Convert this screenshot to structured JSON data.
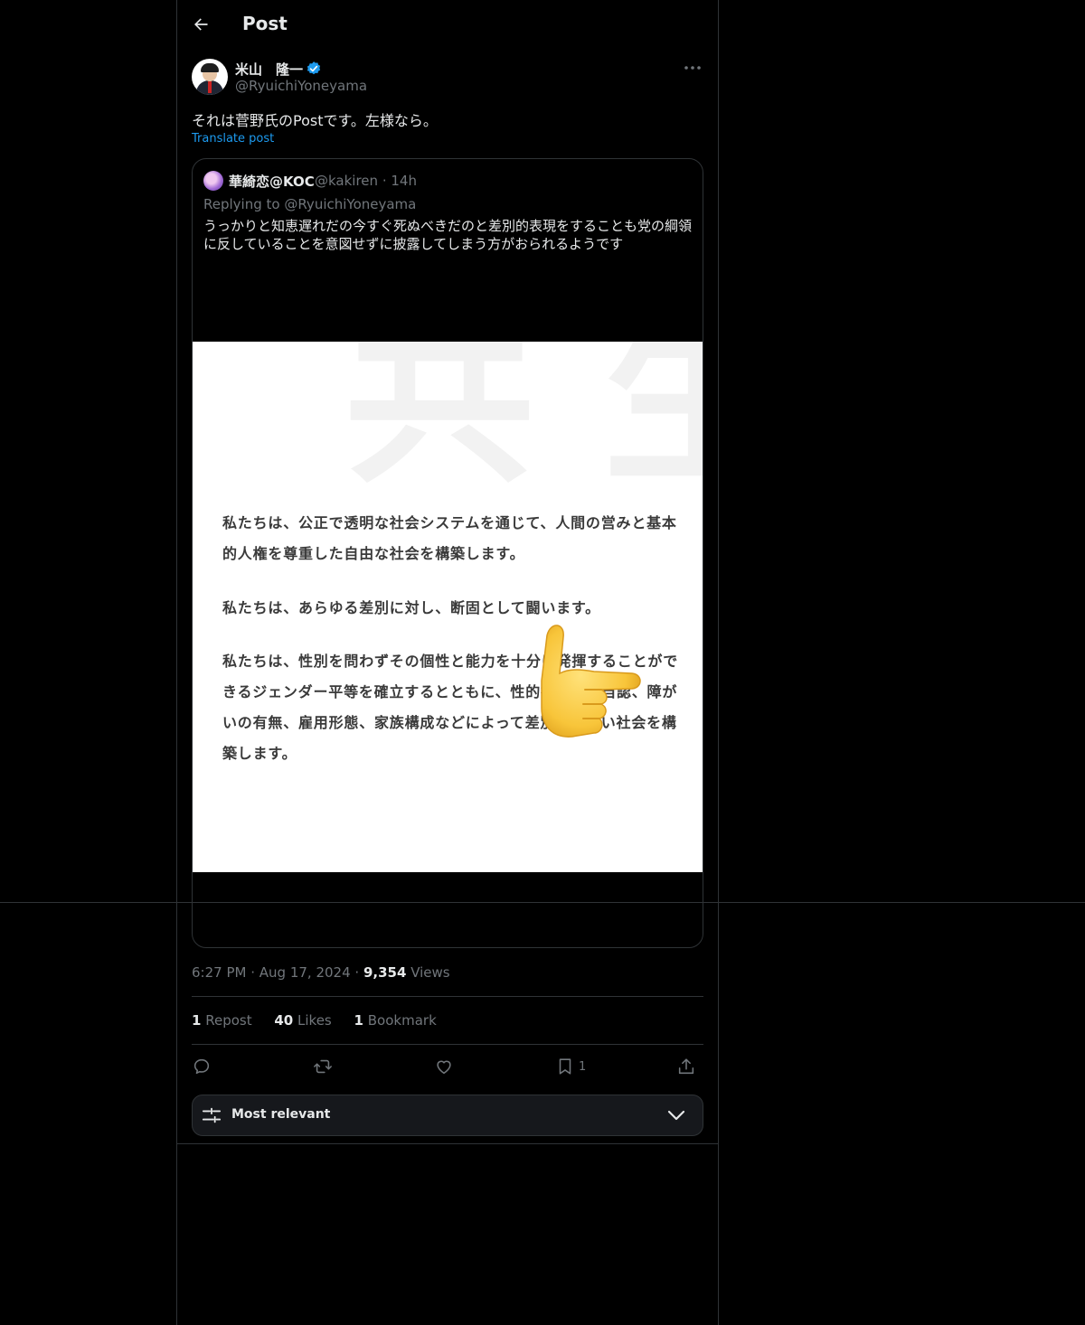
{
  "header": {
    "title": "Post"
  },
  "author": {
    "name": "米山　隆一",
    "handle": "@RyuichiYoneyama"
  },
  "post": {
    "text": "それは菅野氏のPostです。左様なら。",
    "translate_label": "Translate post",
    "time": "6:27 PM",
    "date": "Aug 17, 2024",
    "views_count": "9,354",
    "views_label": "Views"
  },
  "quote": {
    "name": "華綺恋@KOC",
    "handle": "@kakiren",
    "age": "14h",
    "replying_to": "Replying to @RyuichiYoneyama",
    "text": "うっかりと知恵遅れだの今すぐ死ぬべきだのと差別的表現をすることも党の綱領に反していることを意図せずに披露してしまう方がおられるようです",
    "image": {
      "watermark_1": "共",
      "watermark_2": "生",
      "paragraph_1": "私たちは、公正で透明な社会システムを通じて、人間の営みと基本的人権を尊重した自由な社会を構築します。",
      "paragraph_2": "私たちは、あらゆる差別に対し、断固として闘います。",
      "paragraph_3": "私たちは、性別を問わずその個性と能力を十分に発揮することができるジェンダー平等を確立するとともに、性的指向と性自認、障がいの有無、雇用形態、家族構成などによって差別されない社会を構築します。"
    }
  },
  "stats": {
    "reposts_count": "1",
    "reposts_label": "Repost",
    "likes_count": "40",
    "likes_label": "Likes",
    "bookmarks_count": "1",
    "bookmarks_label": "Bookmark"
  },
  "actions": {
    "bookmark_count": "1",
    "icons": [
      "reply-icon",
      "repost-icon",
      "like-icon",
      "bookmark-icon",
      "share-icon"
    ]
  },
  "sort": {
    "label": "Most relevant"
  },
  "colors": {
    "background": "#000000",
    "text": "#e7e9ea",
    "muted": "#71767b",
    "accent": "#1d9bf0",
    "border": "#2f3336"
  }
}
